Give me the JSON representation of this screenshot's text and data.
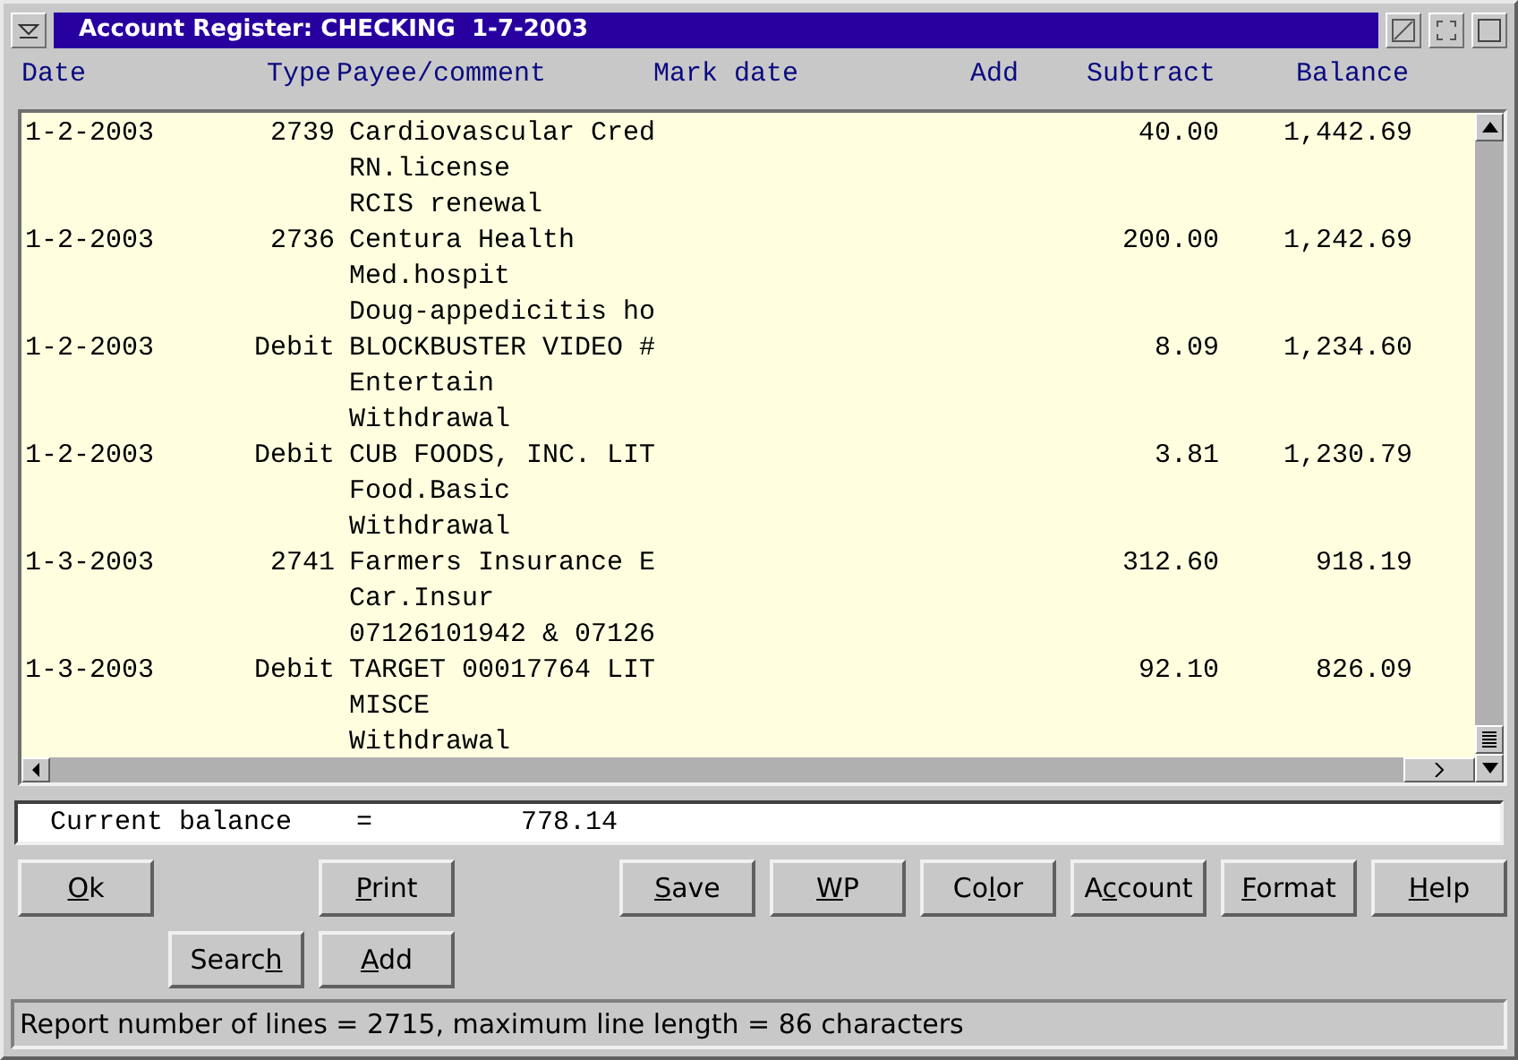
{
  "window": {
    "title": "Account Register: CHECKING  1-7-2003"
  },
  "columns": [
    "Date",
    "Type",
    "Payee/comment",
    "Mark date",
    "Add",
    "Subtract",
    "Balance"
  ],
  "transactions": [
    {
      "date": "1-2-2003",
      "type": "2739",
      "payee_lines": [
        "Cardiovascular Cred",
        "RN.license",
        "RCIS renewal"
      ],
      "subtract": "40.00",
      "balance": "1,442.69"
    },
    {
      "date": "1-2-2003",
      "type": "2736",
      "payee_lines": [
        "Centura Health",
        "Med.hospit",
        "Doug-appedicitis ho"
      ],
      "subtract": "200.00",
      "balance": "1,242.69"
    },
    {
      "date": "1-2-2003",
      "type": "Debit",
      "payee_lines": [
        "BLOCKBUSTER VIDEO #",
        "Entertain",
        "Withdrawal"
      ],
      "subtract": "8.09",
      "balance": "1,234.60"
    },
    {
      "date": "1-2-2003",
      "type": "Debit",
      "payee_lines": [
        "CUB FOODS, INC. LIT",
        "Food.Basic",
        "Withdrawal"
      ],
      "subtract": "3.81",
      "balance": "1,230.79"
    },
    {
      "date": "1-3-2003",
      "type": "2741",
      "payee_lines": [
        "Farmers Insurance E",
        "Car.Insur",
        "07126101942 & 07126"
      ],
      "subtract": "312.60",
      "balance": "918.19"
    },
    {
      "date": "1-3-2003",
      "type": "Debit",
      "payee_lines": [
        "TARGET 00017764 LIT",
        "MISCE",
        "Withdrawal"
      ],
      "subtract": "92.10",
      "balance": "826.09"
    }
  ],
  "current_balance": {
    "label": "Current balance",
    "equals": "=",
    "value": "778.14"
  },
  "button_rows": [
    [
      {
        "key": "O",
        "post": "k"
      },
      {
        "key": "P",
        "post": "rint"
      },
      {
        "key": "S",
        "post": "ave"
      },
      {
        "key": "W",
        "post": "P"
      },
      {
        "pre": "Co",
        "key": "l",
        "post": "or"
      },
      {
        "pre": "A",
        "key": "c",
        "post": "count"
      },
      {
        "key": "F",
        "post": "ormat"
      },
      {
        "key": "H",
        "post": "elp"
      }
    ],
    [
      {
        "pre": "Searc",
        "key": "h"
      },
      {
        "key": "A",
        "post": "dd"
      }
    ]
  ],
  "status_bar": "Report number of lines = 2715, maximum line length = 86 characters"
}
